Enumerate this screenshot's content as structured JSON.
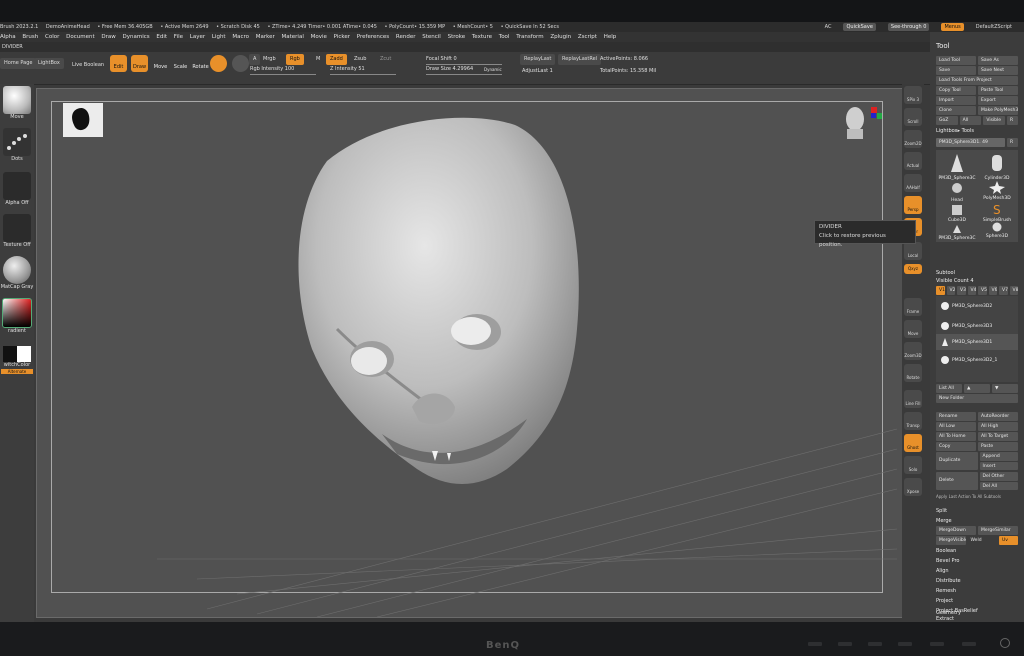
{
  "title_bar": {
    "items": [
      "Brush 2023.2.1",
      "DemoAnimeHead",
      "• Free Mem 36.405GB",
      "• Active Mem 2649",
      "• Scratch Disk 45",
      "• ZTime• 4.249 Timer• 0.001 ATime• 0.045",
      "• PolyCount• 15.359 MP",
      "• MeshCount• 5",
      "• QuickSave In 52 Secs"
    ],
    "ac": "AC",
    "quicksave": "QuickSave",
    "see_through": "See-through 0",
    "menus": "Menus",
    "script": "DefaultZScript"
  },
  "menu_bar": {
    "items": [
      "Alpha",
      "Brush",
      "Color",
      "Document",
      "Draw",
      "Dynamics",
      "Edit",
      "File",
      "Layer",
      "Light",
      "Macro",
      "Marker",
      "Material",
      "Movie",
      "Picker",
      "Preferences",
      "Render",
      "Stencil",
      "Stroke",
      "Texture",
      "Tool",
      "Transform",
      "Zplugin",
      "Zscript",
      "Help"
    ]
  },
  "divider_label": "DIVIDER",
  "toolbar": {
    "home_page": "Home Page",
    "lightbox": "LightBox",
    "live_boolean": "Live Boolean",
    "edit": "Edit",
    "draw": "Draw",
    "move": "Move",
    "scale": "Scale",
    "rotate": "Rotate",
    "mrgb": "Mrgb",
    "rgb": "Rgb",
    "m": "M",
    "zadd": "Zadd",
    "zsub": "Zsub",
    "zcut": "Zcut",
    "rgb_intensity": "Rgb Intensity 100",
    "z_intensity": "Z Intensity 51",
    "focal_shift": "Focal Shift 0",
    "draw_size": "Draw Size 4.29964",
    "dynamic": "Dynamic",
    "replay_last": "ReplayLast",
    "replay_last_rel": "ReplayLastRel",
    "adjust_last": "AdjustLast 1",
    "active_points": "ActivePoints: 8.066",
    "total_points": "TotalPoints: 15.358 Mil"
  },
  "left_shelf": {
    "move": "Move",
    "dots": "Dots",
    "alpha_off": "Alpha Off",
    "texture_off": "Texture Off",
    "matcap": "MatCap Gray",
    "gradient": "radient",
    "switch_color": "witchColor",
    "alternate": "Alternate"
  },
  "right_shelf": {
    "spix": "SPix 3",
    "scroll": "Scroll",
    "zoom2d": "Zoom2D",
    "actual": "Actual",
    "aahalf": "AAHalf",
    "persp": "Persp",
    "floor": "Floor",
    "local": "Local",
    "xyz": "Qxyz",
    "frame": "Frame",
    "move": "Move",
    "zoom3d": "Zoom3D",
    "rotate": "Rotate",
    "linefill": "Line Fill",
    "polyf": "PolyF",
    "transp": "Transp",
    "ghost": "Ghost",
    "solo": "Solo",
    "xpose": "Xpose"
  },
  "tooltip": {
    "title": "DIVIDER",
    "text": "Click to restore previous position."
  },
  "tool_panel": {
    "title": "Tool",
    "row1": [
      "Load Tool",
      "Save As"
    ],
    "row2": [
      "Save",
      "Save Next"
    ],
    "row3": [
      "Load Tools From Project"
    ],
    "row4": [
      "Copy Tool",
      "Paste Tool"
    ],
    "row5": [
      "Import",
      "Export"
    ],
    "row6": [
      "Clone",
      "Make PolyMesh3D"
    ],
    "row7": [
      "GoZ",
      "All",
      "Visible",
      "R"
    ],
    "lightbox_tools": "Lightbox▸ Tools",
    "current_tool": "PM3D_Sphere3D1. 49",
    "current_tool_r": "R",
    "grid": [
      {
        "label": "PM3D_Sphere3C",
        "count": "5"
      },
      {
        "label": "Cylinder3D",
        "count": ""
      },
      {
        "label": "",
        "count": ""
      },
      {
        "label": "PolyMesh3D",
        "count": ""
      },
      {
        "label": "Head",
        "count": ""
      },
      {
        "label": "SimpleBrush",
        "count": ""
      },
      {
        "label": "Cube3D",
        "count": ""
      },
      {
        "label": "Sphere3D",
        "count": ""
      },
      {
        "label": "PM3D_Sphere3C",
        "count": "5"
      }
    ],
    "subtool": "Subtool",
    "visible_count": "Visible Count 4",
    "v_buttons": [
      "V1",
      "V2",
      "V3",
      "V4",
      "V5",
      "V6",
      "V7",
      "V8"
    ],
    "subtools": [
      "PM3D_Sphere3D2",
      "PM3D_Sphere3D3",
      "PM3D_Sphere3D1",
      "PM3D_Sphere3D2_1"
    ],
    "list_all": "List All",
    "new_folder": "New Folder",
    "rename": "Rename",
    "autoreorder": "AutoReorder",
    "all_low": "All Low",
    "all_high": "All High",
    "all_to_home": "All To Home",
    "all_to_target": "All To Target",
    "copy": "Copy",
    "paste": "Paste",
    "duplicate": "Duplicate",
    "append": "Append",
    "insert": "Insert",
    "delete": "Delete",
    "del_other": "Del Other",
    "del_all": "Del All",
    "apply_last": "Apply Last Action To All Subtools",
    "split": "Split",
    "merge": "Merge",
    "merge_down": "MergeDown",
    "merge_similar": "MergeSimilar",
    "merge_visible": "MergeVisible",
    "weld": "Weld",
    "uv": "Uv",
    "sections": [
      "Boolean",
      "Bevel Pro",
      "Align",
      "Distribute",
      "Remesh",
      "Project",
      "Project BasRelief",
      "Extract",
      "Nrdshift Properties"
    ],
    "geometry": "Geometry"
  },
  "monitor": {
    "brand": "BenQ"
  }
}
